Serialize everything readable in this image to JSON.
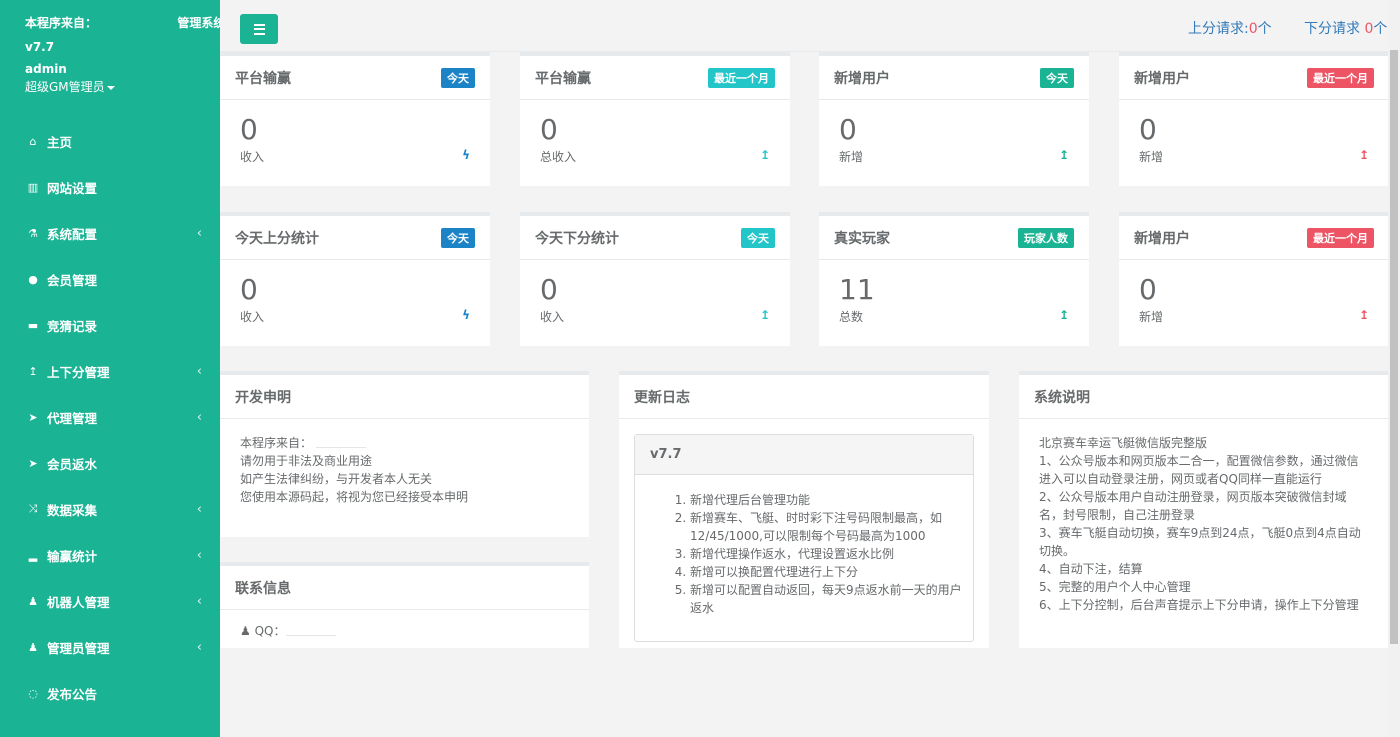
{
  "sidebar": {
    "source_label": "本程序来自：",
    "system_suffix": "管理系统",
    "version": "v7.7",
    "username": "admin",
    "role": "超级GM管理员",
    "items": [
      {
        "icon": "home-icon",
        "glyph": "⌂",
        "label": "主页",
        "has_arrow": false
      },
      {
        "icon": "columns-icon",
        "glyph": "▥",
        "label": "网站设置",
        "has_arrow": false
      },
      {
        "icon": "flask-icon",
        "glyph": "⚗",
        "label": "系统配置",
        "has_arrow": true
      },
      {
        "icon": "user-icon",
        "glyph": "●",
        "label": "会员管理",
        "has_arrow": false
      },
      {
        "icon": "car-icon",
        "glyph": "▬",
        "label": "竞猜记录",
        "has_arrow": false
      },
      {
        "icon": "level-up-icon",
        "glyph": "↥",
        "label": "上下分管理",
        "has_arrow": true
      },
      {
        "icon": "paper-plane-icon",
        "glyph": "➤",
        "label": "代理管理",
        "has_arrow": true
      },
      {
        "icon": "paper-plane-icon",
        "glyph": "➤",
        "label": "会员返水",
        "has_arrow": false
      },
      {
        "icon": "random-icon",
        "glyph": "⤨",
        "label": "数据采集",
        "has_arrow": true
      },
      {
        "icon": "bar-chart-icon",
        "glyph": "▂",
        "label": "输赢统计",
        "has_arrow": true
      },
      {
        "icon": "male-icon",
        "glyph": "♟",
        "label": "机器人管理",
        "has_arrow": true
      },
      {
        "icon": "male-icon",
        "glyph": "♟",
        "label": "管理员管理",
        "has_arrow": true
      },
      {
        "icon": "comment-icon",
        "glyph": "◌",
        "label": "发布公告",
        "has_arrow": false
      }
    ]
  },
  "topbar": {
    "up_request_label": "上分请求:",
    "up_request_count": "0",
    "up_request_unit": "个",
    "down_request_label": "下分请求",
    "down_request_count": "0",
    "down_request_unit": "个"
  },
  "stats": [
    {
      "title": "平台输赢",
      "badge": "今天",
      "badge_class": "l-blue",
      "value": "0",
      "sub": "收入",
      "trend": "ϟ",
      "trend_class": "c-blue",
      "trend_icon": "bolt-icon"
    },
    {
      "title": "平台输赢",
      "badge": "最近一个月",
      "badge_class": "l-info",
      "value": "0",
      "sub": "总收入",
      "trend": "↥",
      "trend_class": "c-info",
      "trend_icon": "level-up-icon"
    },
    {
      "title": "新增用户",
      "badge": "今天",
      "badge_class": "l-prim",
      "value": "0",
      "sub": "新增",
      "trend": "↥",
      "trend_class": "c-prim",
      "trend_icon": "level-up-icon"
    },
    {
      "title": "新增用户",
      "badge": "最近一个月",
      "badge_class": "l-red",
      "value": "0",
      "sub": "新增",
      "trend": "↥",
      "trend_class": "c-red",
      "trend_icon": "level-up-icon"
    },
    {
      "title": "今天上分统计",
      "badge": "今天",
      "badge_class": "l-blue",
      "value": "0",
      "sub": "收入",
      "trend": "ϟ",
      "trend_class": "c-blue",
      "trend_icon": "bolt-icon"
    },
    {
      "title": "今天下分统计",
      "badge": "今天",
      "badge_class": "l-info",
      "value": "0",
      "sub": "收入",
      "trend": "↥",
      "trend_class": "c-info",
      "trend_icon": "level-up-icon"
    },
    {
      "title": "真实玩家",
      "badge": "玩家人数",
      "badge_class": "l-prim",
      "value": "11",
      "sub": "总数",
      "trend": "↥",
      "trend_class": "c-prim",
      "trend_icon": "level-up-icon"
    },
    {
      "title": "新增用户",
      "badge": "最近一个月",
      "badge_class": "l-red",
      "value": "0",
      "sub": "新增",
      "trend": "↥",
      "trend_class": "c-red",
      "trend_icon": "level-up-icon"
    }
  ],
  "dev_notice": {
    "title": "开发申明",
    "lines": [
      "本程序来自：",
      "请勿用于非法及商业用途",
      "如产生法律纠纷，与开发者本人无关",
      "您使用本源码起，将视为您已经接受本申明"
    ]
  },
  "contact": {
    "title": "联系信息",
    "qq_label": "QQ："
  },
  "changelog": {
    "title": "更新日志",
    "version": "v7.7",
    "items": [
      "新增代理后台管理功能",
      "新增赛车、飞艇、时时彩下注号码限制最高，如12/45/1000,可以限制每个号码最高为1000",
      "新增代理操作返水，代理设置返水比例",
      "新增可以换配置代理进行上下分",
      "新增可以配置自动返回，每天9点返水前一天的用户返水"
    ]
  },
  "system_info": {
    "title": "系统说明",
    "lines": [
      "北京赛车幸运飞艇微信版完整版",
      "1、公众号版本和网页版本二合一，配置微信参数，通过微信进入可以自动登录注册，网页或者QQ同样一直能运行",
      "2、公众号版本用户自动注册登录，网页版本突破微信封域名，封号限制，自己注册登录",
      "3、赛车飞艇自动切换，赛车9点到24点，飞艇0点到4点自动切换。",
      "4、自动下注，结算",
      "5、完整的用户个人中心管理",
      "6、上下分控制，后台声音提示上下分申请，操作上下分管理"
    ]
  }
}
